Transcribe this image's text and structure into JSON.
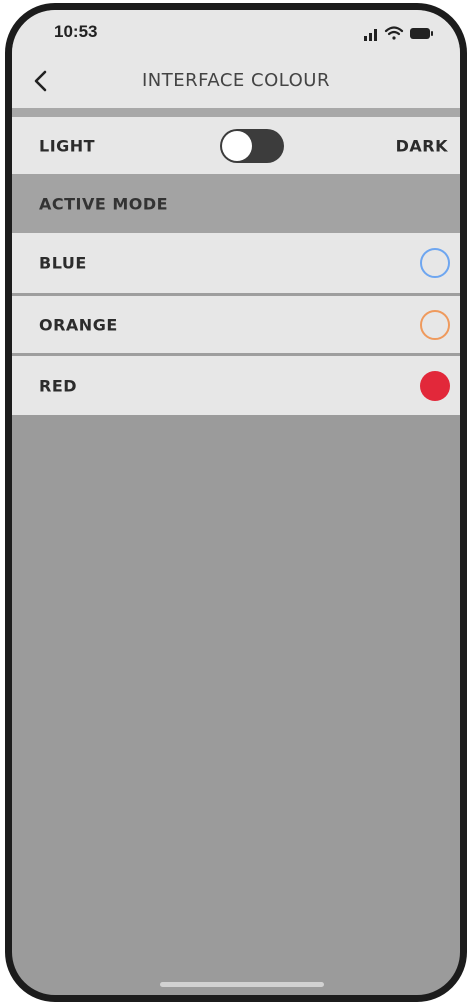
{
  "status": {
    "time": "10:53"
  },
  "header": {
    "title": "INTERFACE COLOUR",
    "back_icon": "chevron-left-icon"
  },
  "theme": {
    "light_label": "LIGHT",
    "dark_label": "DARK",
    "dark_enabled": false
  },
  "section": {
    "title": "ACTIVE MODE"
  },
  "colours": [
    {
      "label": "BLUE",
      "color": "#6ea6f0",
      "selected": false
    },
    {
      "label": "ORANGE",
      "color": "#ef9a5d",
      "selected": false
    },
    {
      "label": "RED",
      "color": "#e2283a",
      "selected": true
    }
  ],
  "style": {
    "row_bg": "#e7e7e7",
    "page_bg": "#9b9b9b",
    "toggle_track": "#3c3c3c"
  }
}
